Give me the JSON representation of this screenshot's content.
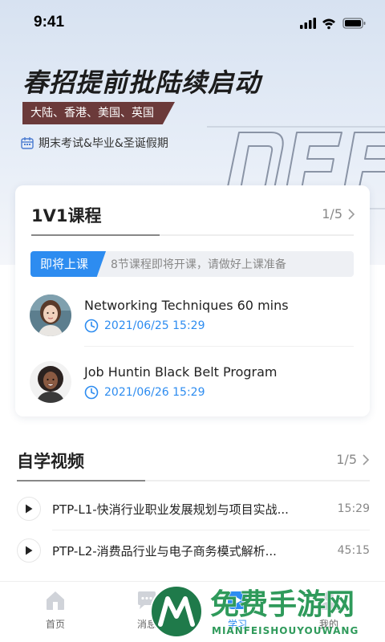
{
  "status_bar": {
    "time": "9:41"
  },
  "banner": {
    "title": "春招提前批陆续启动",
    "regions": "大陆、香港、美国、英国",
    "subline": "期末考试&毕业&圣诞假期"
  },
  "course_section": {
    "title": "1V1课程",
    "pager": "1/5",
    "notice_badge": "即将上课",
    "notice_text": "8节课程即将开课，请做好上课准备",
    "lessons": [
      {
        "title": "Networking Techniques 60 mins",
        "time": "2021/06/25 15:29"
      },
      {
        "title": "Job Huntin Black Belt Program",
        "time": "2021/06/26 15:29"
      }
    ]
  },
  "video_section": {
    "title": "自学视频",
    "pager": "1/5",
    "videos": [
      {
        "title": "PTP-L1-快消行业职业发展规划与项目实战...",
        "duration": "15:29"
      },
      {
        "title": "PTP-L2-消费品行业与电子商务模式解析...",
        "duration": "45:15"
      }
    ]
  },
  "tabbar": {
    "items": [
      {
        "label": "首页",
        "icon": "home-icon"
      },
      {
        "label": "消息",
        "icon": "chat-icon"
      },
      {
        "label": "学习",
        "icon": "play-icon"
      },
      {
        "label": "我的",
        "icon": "user-icon"
      }
    ]
  },
  "watermark": {
    "cn": "免费手游网",
    "en": "MIANFEISHOUYOUWANG"
  },
  "colors": {
    "accent": "#2d8cf0",
    "ribbon": "#6b3a3a",
    "hero_bg": "#dfe7f3"
  }
}
